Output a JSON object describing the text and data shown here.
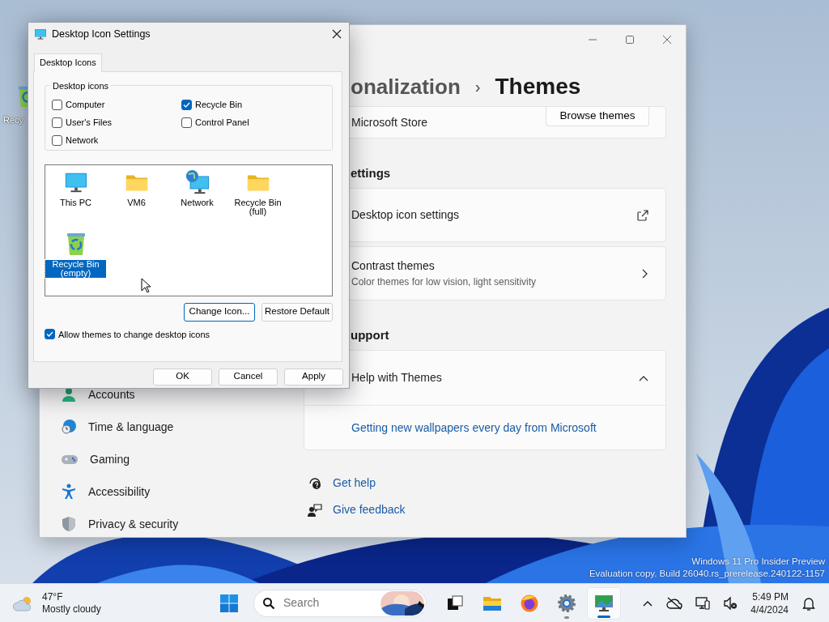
{
  "desktop": {
    "icons": [
      {
        "label": "Recy"
      }
    ],
    "watermark": [
      "Windows 11 Pro Insider Preview",
      "Evaluation copy. Build 26040.rs_prerelease.240122-1157"
    ]
  },
  "settings_window": {
    "breadcrumb": {
      "parent": "onalization",
      "separator": "›",
      "current": "Themes"
    },
    "sidebar": {
      "items": [
        {
          "label": "Accounts",
          "kind": "accounts"
        },
        {
          "label": "Time & language",
          "kind": "time"
        },
        {
          "label": "Gaming",
          "kind": "gaming"
        },
        {
          "label": "Accessibility",
          "kind": "accessibility"
        },
        {
          "label": "Privacy & security",
          "kind": "privacy"
        }
      ]
    },
    "store_card": {
      "label": "Microsoft Store",
      "button": "Browse themes"
    },
    "sections": [
      {
        "heading": "ettings",
        "cards": [
          {
            "title": "Desktop icon settings",
            "kind": "external"
          },
          {
            "title": "Contrast themes",
            "subtitle": "Color themes for low vision, light sensitivity",
            "kind": "chevron"
          }
        ]
      },
      {
        "heading": "upport",
        "cards": [
          {
            "title": "Help with Themes",
            "kind": "expander",
            "expanded": true,
            "links": [
              "Getting new wallpapers every day from Microsoft"
            ]
          }
        ]
      }
    ],
    "help_links": [
      {
        "label": "Get help",
        "kind": "help"
      },
      {
        "label": "Give feedback",
        "kind": "feedback"
      }
    ]
  },
  "dialog": {
    "title": "Desktop Icon Settings",
    "tabs": [
      {
        "label": "Desktop Icons",
        "selected": true
      }
    ],
    "group": {
      "legend": "Desktop icons",
      "checkboxes": [
        {
          "label": "Computer",
          "checked": false
        },
        {
          "label": "User's Files",
          "checked": false
        },
        {
          "label": "Network",
          "checked": false
        },
        {
          "label": "Recycle Bin",
          "checked": true
        },
        {
          "label": "Control Panel",
          "checked": false
        }
      ]
    },
    "icons": [
      {
        "label": "This PC",
        "kind": "monitor",
        "selected": false
      },
      {
        "label": "VM6",
        "kind": "folder",
        "selected": false
      },
      {
        "label": "Network",
        "kind": "network",
        "selected": false
      },
      {
        "label": "Recycle Bin (full)",
        "kind": "folder",
        "selected": false
      },
      {
        "label": "Recycle Bin (empty)",
        "kind": "recycle",
        "selected": true
      }
    ],
    "icon_buttons": [
      {
        "label": "Change Icon...",
        "focused": true
      },
      {
        "label": "Restore Default",
        "focused": false
      }
    ],
    "allow_themes": {
      "label": "Allow themes to change desktop icons",
      "checked": true
    },
    "buttons": [
      "OK",
      "Cancel",
      "Apply"
    ]
  },
  "taskbar": {
    "weather": {
      "temperature": "47°F",
      "condition": "Mostly cloudy"
    },
    "search": {
      "placeholder": "Search"
    },
    "apps": [
      {
        "kind": "task-view",
        "open": false,
        "active": false
      },
      {
        "kind": "folder",
        "open": false,
        "active": false
      },
      {
        "kind": "browser",
        "open": false,
        "active": false
      },
      {
        "kind": "settings",
        "open": true,
        "active": false
      },
      {
        "kind": "desktop-icons",
        "open": true,
        "active": true
      }
    ],
    "clock": {
      "time": "5:49 PM",
      "date": "4/4/2024"
    }
  }
}
